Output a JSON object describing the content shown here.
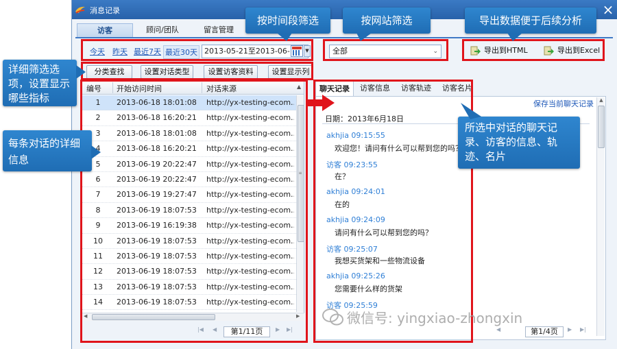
{
  "window": {
    "title": "消息记录",
    "close": "×"
  },
  "main_tabs": [
    {
      "label": "访客",
      "active": true
    },
    {
      "label": "顾问/团队",
      "active": false
    },
    {
      "label": "留言管理",
      "active": false
    }
  ],
  "filters": {
    "ranges": [
      "今天",
      "昨天",
      "最近7天",
      "最近30天"
    ],
    "selected_range": "最近30天",
    "date_range": "2013-05-21至2013-06-19",
    "site_select": "全部",
    "export_html": "导出到HTML",
    "export_excel": "导出到Excel"
  },
  "tool_buttons": [
    "分类查找",
    "设置对话类型",
    "设置访客资料",
    "设置显示列"
  ],
  "table": {
    "headers": [
      "编号",
      "开始访问时间",
      "对话来源"
    ],
    "rows": [
      {
        "num": "1",
        "time": "2013-06-18 18:01:08",
        "source": "http://yx-testing-ecom...",
        "selected": true
      },
      {
        "num": "2",
        "time": "2013-06-18 16:20:21",
        "source": "http://yx-testing-ecom..."
      },
      {
        "num": "3",
        "time": "2013-06-18 18:01:08",
        "source": "http://yx-testing-ecom..."
      },
      {
        "num": "4",
        "time": "2013-06-18 16:20:21",
        "source": "http://yx-testing-ecom..."
      },
      {
        "num": "5",
        "time": "2013-06-19 20:22:47",
        "source": "http://yx-testing-ecom..."
      },
      {
        "num": "6",
        "time": "2013-06-19 20:22:47",
        "source": "http://yx-testing-ecom..."
      },
      {
        "num": "7",
        "time": "2013-06-19 19:27:47",
        "source": "http://yx-testing-ecom..."
      },
      {
        "num": "8",
        "time": "2013-06-19 18:07:53",
        "source": "http://yx-testing-ecom..."
      },
      {
        "num": "9",
        "time": "2013-06-19 16:19:38",
        "source": "http://yx-testing-ecom..."
      },
      {
        "num": "10",
        "time": "2013-06-19 18:07:53",
        "source": "http://yx-testing-ecom..."
      },
      {
        "num": "11",
        "time": "2013-06-19 18:07:53",
        "source": "http://yx-testing-ecom..."
      },
      {
        "num": "12",
        "time": "2013-06-19 18:07:53",
        "source": "http://yx-testing-ecom..."
      },
      {
        "num": "13",
        "time": "2013-06-19 18:07:53",
        "source": "http://yx-testing-ecom..."
      },
      {
        "num": "14",
        "time": "2013-06-19 18:07:53",
        "source": "http://yx-testing-ecom..."
      }
    ],
    "pager": "第1/11页"
  },
  "chat": {
    "tabs": [
      "聊天记录",
      "访客信息",
      "访客轨迹",
      "访客名片"
    ],
    "active_tab": "聊天记录",
    "save_link": "保存当前聊天记录",
    "date": "日期：2013年6月18日",
    "messages": [
      {
        "head": "akhjia 09:15:55",
        "body": "欢迎您！请问有什么可以帮到您的吗？"
      },
      {
        "head": "访客 09:23:55",
        "body": "在？"
      },
      {
        "head": "akhjia 09:24:01",
        "body": "在的"
      },
      {
        "head": "akhjia 09:24:09",
        "body": "请问有什么可以帮到您的吗？"
      },
      {
        "head": "访客 09:25:07",
        "body": "我想买货架和一些物流设备"
      },
      {
        "head": "akhjia 09:25:26",
        "body": "您需要什么样的货架"
      },
      {
        "head": "访客 09:25:59",
        "body": ""
      }
    ],
    "pager": "第1/4页",
    "name_color": "#2f7fd6"
  },
  "callouts": {
    "time_filter": "按时间段筛选",
    "site_filter": "按网站筛选",
    "export": "导出数据便于后续分析",
    "detail_filter": "详细筛选选项，设置显示哪些指标",
    "each_dialog": "每条对话的详细信息",
    "chat_detail": "所选中对话的聊天记录、访客的信息、轨迹、名片"
  },
  "watermark": "微信号: yingxiao-zhongxin",
  "colors": {
    "accent": "#e0141b",
    "callout": "#2677c2",
    "titlebar": "#2f6cb5"
  }
}
